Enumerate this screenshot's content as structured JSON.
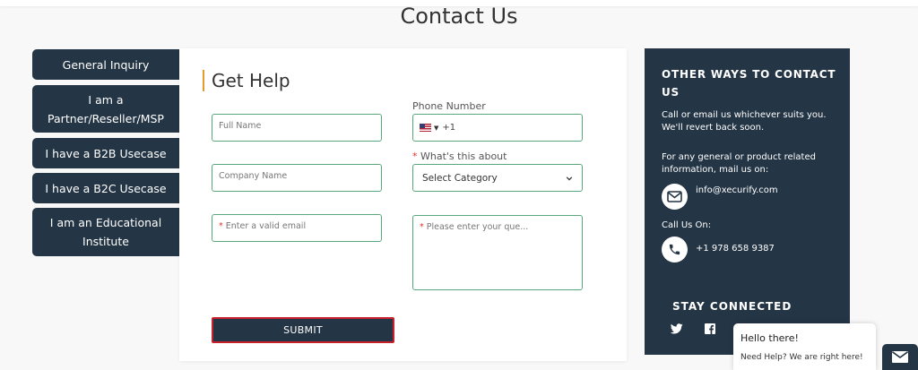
{
  "page": {
    "title": "Contact Us"
  },
  "tabs": [
    {
      "label": "General Inquiry"
    },
    {
      "label": "I am a Partner/Reseller/MSP"
    },
    {
      "label": "I have a B2B Usecase"
    },
    {
      "label": "I have a B2C Usecase"
    },
    {
      "label": "I am an Educational Institute"
    }
  ],
  "form": {
    "heading": "Get Help",
    "full_name_placeholder": "Full Name",
    "company_placeholder": "Company Name",
    "email_placeholder": "Enter a valid email",
    "phone_label": "Phone Number",
    "phone_code": "+1",
    "category_label": "What's this about",
    "category_selected": "Select Category",
    "query_placeholder": "Please enter your que...",
    "required_mark": "*",
    "submit_label": "SUBMIT"
  },
  "contact": {
    "title": "OTHER WAYS TO CONTACT US",
    "intro": "Call or email us whichever suits you. We'll revert back soon.",
    "mail_info": "For any general or product related information, mail us on:",
    "email": "info@xecurify.com",
    "call_label": "Call Us On:",
    "phone": "+1 978 658 9387",
    "stay_connected": "STAY CONNECTED",
    "icons": {
      "mail": "envelope-icon",
      "phone": "phone-icon",
      "twitter": "twitter-icon",
      "facebook": "facebook-icon"
    }
  },
  "chat": {
    "hello": "Hello there!",
    "help": "Need Help? We are right here!",
    "icon": "envelope-icon"
  },
  "colors": {
    "navy": "#243545",
    "accent": "#e69a2c",
    "input_border": "#5aa77d",
    "submit_border": "#c8202d"
  }
}
